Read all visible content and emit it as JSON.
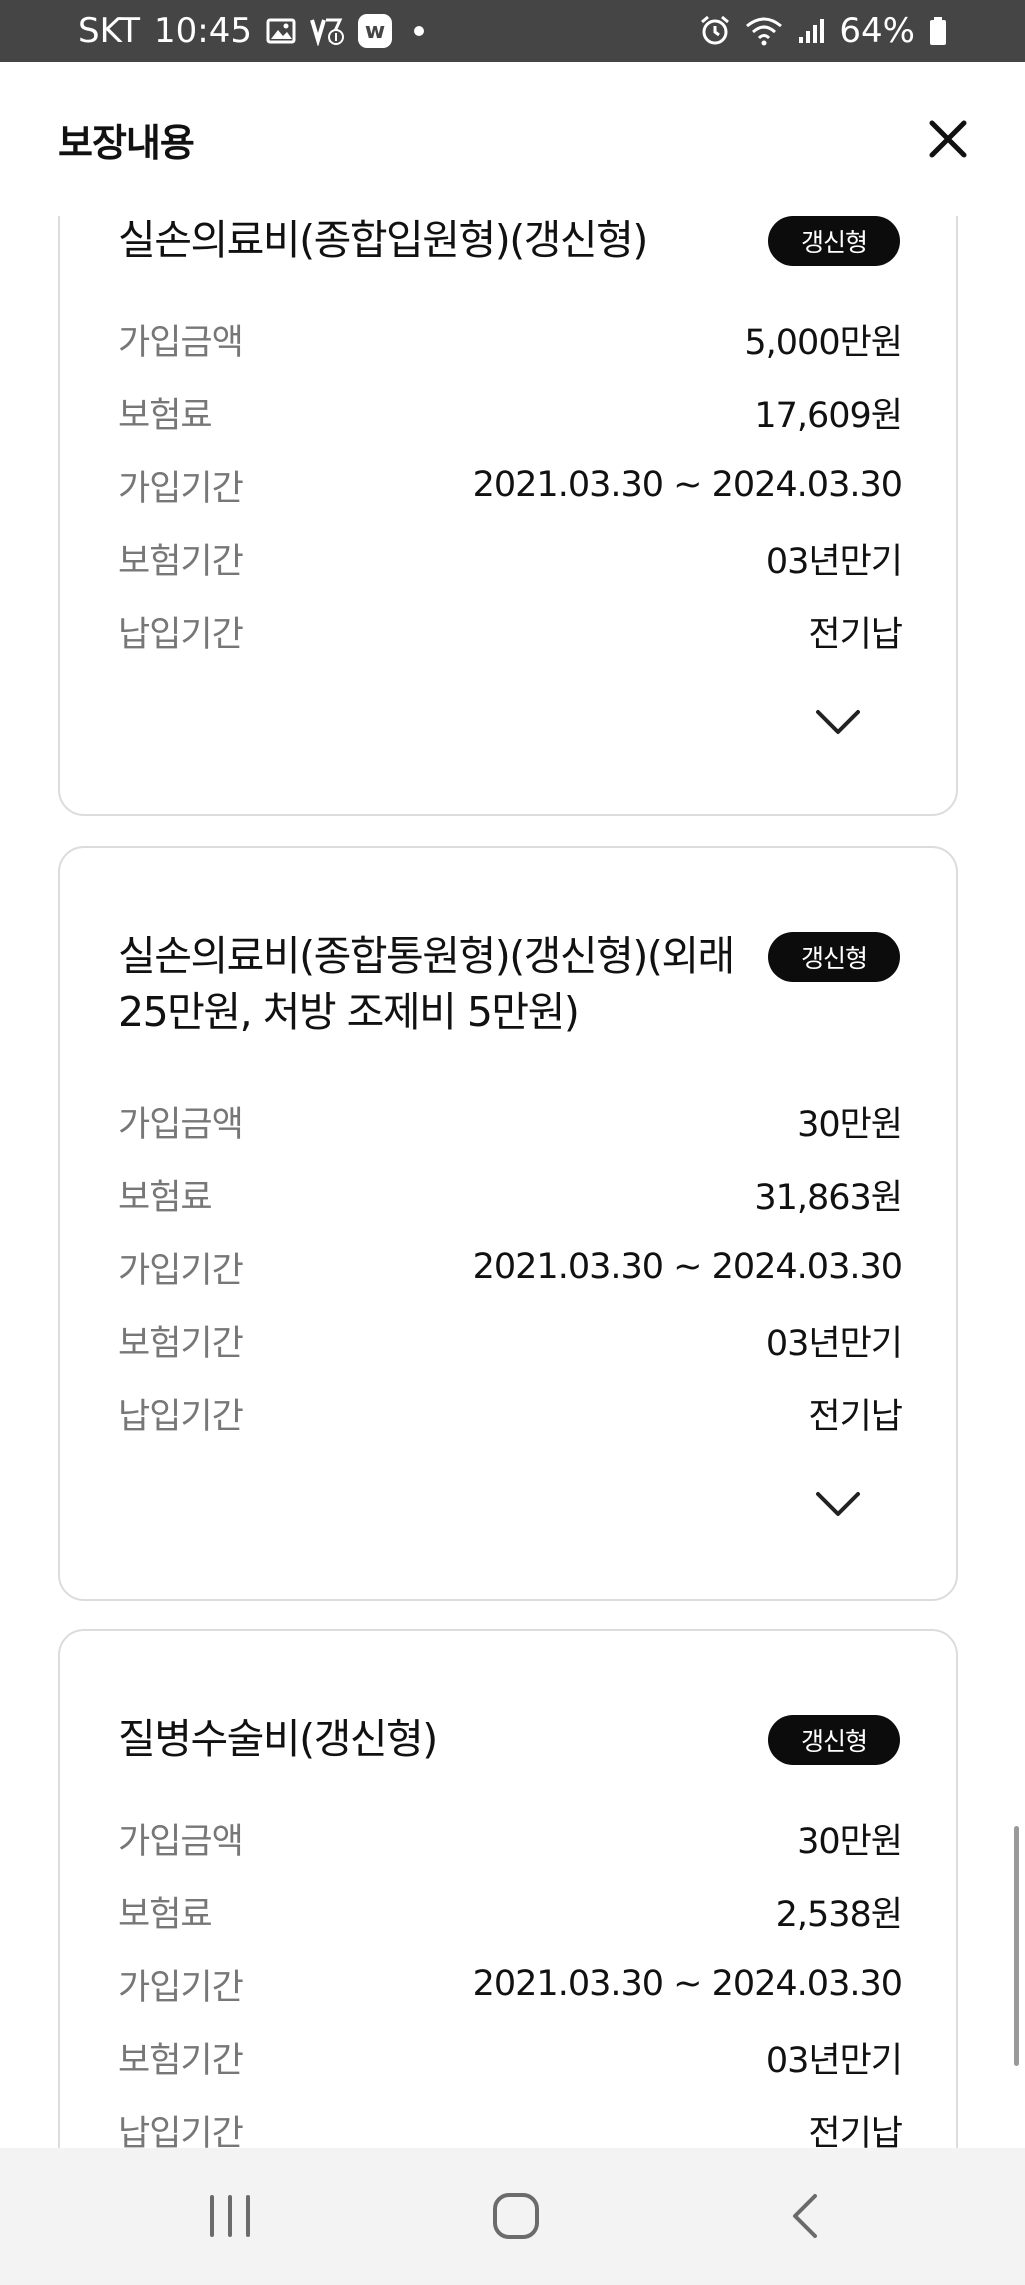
{
  "status_bar": {
    "carrier": "SKT",
    "time": "10:45",
    "battery": "64%"
  },
  "header": {
    "title": "보장내용"
  },
  "cards": [
    {
      "title": "실손의료비(종합입원형)(갱신형)",
      "badge": "갱신형",
      "rows": [
        {
          "label": "가입금액",
          "value": "5,000만원"
        },
        {
          "label": "보험료",
          "value": "17,609원"
        },
        {
          "label": "가입기간",
          "value": "2021.03.30 ~ 2024.03.30"
        },
        {
          "label": "보험기간",
          "value": "03년만기"
        },
        {
          "label": "납입기간",
          "value": "전기납"
        }
      ]
    },
    {
      "title": "실손의료비(종합통원형)(갱신형)(외래25만원, 처방 조제비 5만원)",
      "badge": "갱신형",
      "rows": [
        {
          "label": "가입금액",
          "value": "30만원"
        },
        {
          "label": "보험료",
          "value": "31,863원"
        },
        {
          "label": "가입기간",
          "value": "2021.03.30 ~ 2024.03.30"
        },
        {
          "label": "보험기간",
          "value": "03년만기"
        },
        {
          "label": "납입기간",
          "value": "전기납"
        }
      ]
    },
    {
      "title": "질병수술비(갱신형)",
      "badge": "갱신형",
      "rows": [
        {
          "label": "가입금액",
          "value": "30만원"
        },
        {
          "label": "보험료",
          "value": "2,538원"
        },
        {
          "label": "가입기간",
          "value": "2021.03.30 ~ 2024.03.30"
        },
        {
          "label": "보험기간",
          "value": "03년만기"
        },
        {
          "label": "납입기간",
          "value": "전기납"
        }
      ]
    }
  ]
}
